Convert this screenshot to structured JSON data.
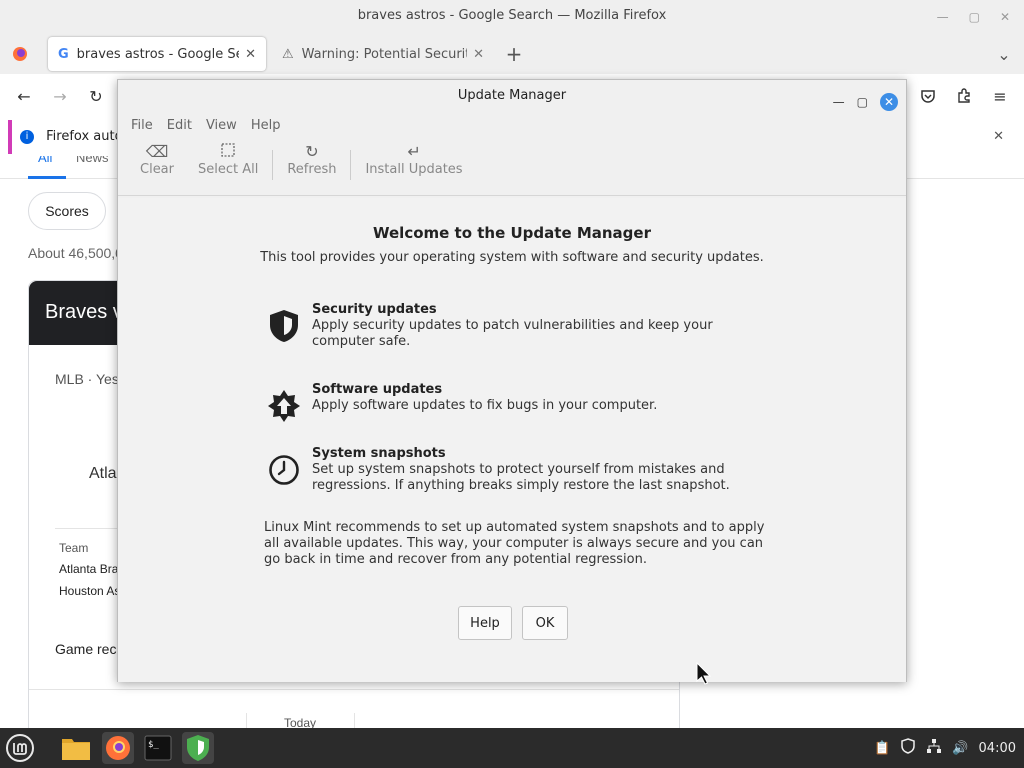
{
  "firefox": {
    "window_title": "braves astros - Google Search — Mozilla Firefox",
    "tabs": [
      {
        "label": "braves astros - Google Search"
      },
      {
        "label": "Warning: Potential Security Risk Ahead"
      }
    ],
    "notification": "Firefox auto",
    "content": {
      "nav_tab_all": "All",
      "nav_tab_news": "News",
      "scores_chip": "Scores",
      "results_count": "About 46,500,0",
      "card_header": "Braves v",
      "card_sub": "MLB · Yes",
      "team_partial": "Atla",
      "table_header": "Team",
      "row1": "Atlanta Bra",
      "row2": "Houston As",
      "game_recap": "Game rec",
      "today": "Today"
    }
  },
  "dialog": {
    "title": "Update Manager",
    "menu": [
      "File",
      "Edit",
      "View",
      "Help"
    ],
    "toolbar": {
      "clear": "Clear",
      "select_all": "Select All",
      "refresh": "Refresh",
      "install_updates": "Install Updates"
    },
    "welcome_heading": "Welcome to the Update Manager",
    "welcome_sub": "This tool provides your operating system with software and security updates.",
    "features": [
      {
        "title": "Security updates",
        "desc": "Apply security updates to patch vulnerabilities and keep your computer safe.",
        "icon": "shield-icon"
      },
      {
        "title": "Software updates",
        "desc": "Apply software updates to fix bugs in your computer.",
        "icon": "upgrade-star-icon"
      },
      {
        "title": "System snapshots",
        "desc": "Set up system snapshots to protect yourself from mistakes and regressions. If anything breaks simply restore the last snapshot.",
        "icon": "clock-icon"
      }
    ],
    "recommend": "Linux Mint recommends to set up automated system snapshots and to apply all available updates. This way, your computer is always secure and you can go back in time and recover from any potential regression.",
    "help_button": "Help",
    "ok_button": "OK"
  },
  "taskbar": {
    "clock": "04:00"
  },
  "colors": {
    "accent": "#3d8ee6",
    "taskbar": "#2b2b2b",
    "update_manager_green": "#4caf50",
    "firefox_orange": "#ff7139"
  }
}
